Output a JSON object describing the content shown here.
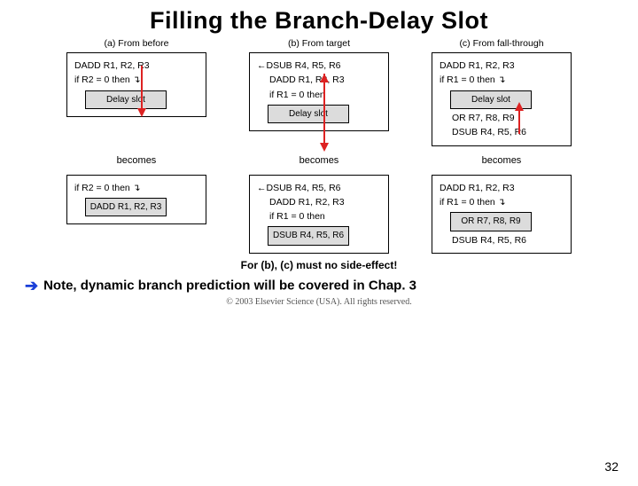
{
  "title": "Filling the Branch-Delay Slot",
  "columns": [
    {
      "label": "(a)  From before",
      "top": {
        "lines": [
          "DADD R1, R2, R3",
          "",
          "if R2 = 0 then"
        ],
        "slot": "Delay slot"
      },
      "becomes": "becomes",
      "bottom": {
        "lines": [
          "",
          "if R2 = 0 then"
        ],
        "slot": "DADD R1, R2, R3"
      }
    },
    {
      "label": "(b)  From target",
      "top": {
        "lines": [
          "DSUB R4, R5, R6",
          "",
          "DADD R1, R2, R3",
          "",
          "if R1 = 0 then"
        ],
        "slot": "Delay slot"
      },
      "becomes": "becomes",
      "bottom": {
        "lines": [
          "DSUB R4, R5, R6",
          "",
          "DADD R1, R2, R3",
          "",
          "if R1 = 0 then"
        ],
        "slot": "DSUB R4, R5, R6"
      }
    },
    {
      "label": "(c)  From fall-through",
      "top": {
        "lines": [
          "DADD R1, R2, R3",
          "",
          "if R1 = 0 then"
        ],
        "slot": "Delay slot",
        "afterSlot": [
          "OR R7, R8, R9",
          "",
          "DSUB R4, R5, R6"
        ]
      },
      "becomes": "becomes",
      "bottom": {
        "lines": [
          "DADD R1, R2, R3",
          "",
          "if R1 = 0 then"
        ],
        "slot": "OR R7, R8, R9",
        "afterSlot": [
          "",
          "DSUB R4, R5, R6"
        ]
      }
    }
  ],
  "caption": "For (b), (c) must no side-effect!",
  "note": "Note, dynamic branch prediction will be covered in Chap. 3",
  "copyright": "© 2003 Elsevier Science (USA). All rights reserved.",
  "pagenum": "32",
  "colors": {
    "red_arrow": "#d22",
    "blue_arrow": "#1a3fd8"
  }
}
